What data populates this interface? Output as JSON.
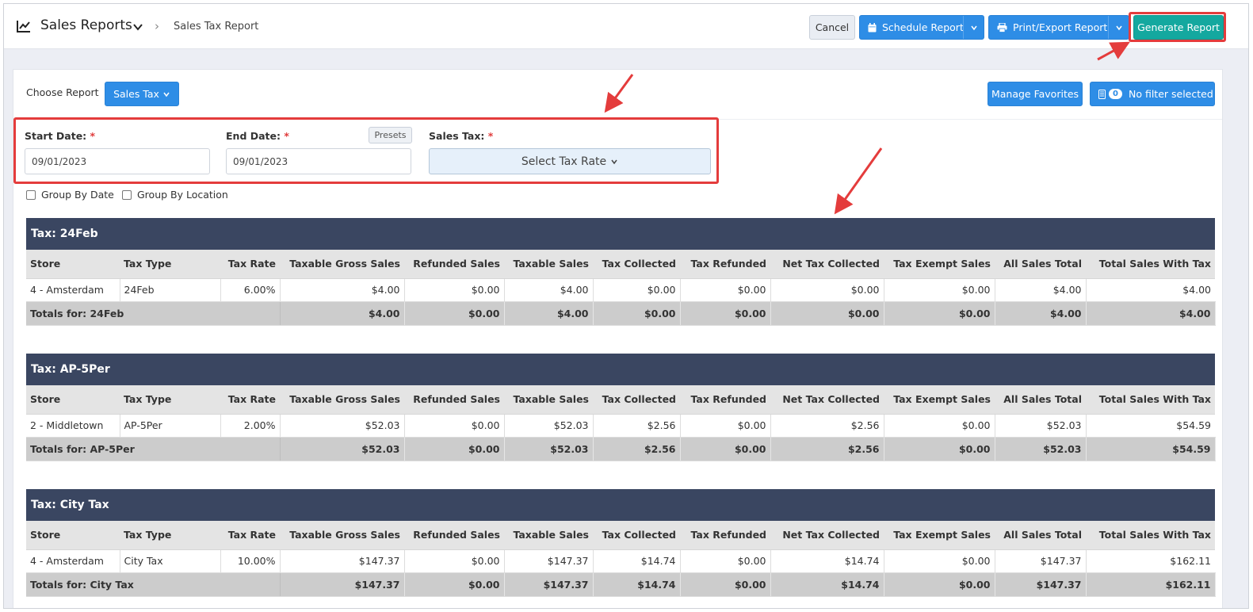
{
  "header": {
    "title": "Sales Reports",
    "breadcrumb_current": "Sales Tax Report",
    "cancel_label": "Cancel",
    "schedule_label": "Schedule Report",
    "print_label": "Print/Export Report",
    "generate_label": "Generate Report"
  },
  "controls": {
    "choose_report_label": "Choose Report",
    "report_select_value": "Sales Tax",
    "manage_favorites_label": "Manage Favorites",
    "filter_count": "0",
    "filter_label": "No filter selected"
  },
  "form": {
    "start_date_label": "Start Date:",
    "start_date_value": "09/01/2023",
    "end_date_label": "End Date:",
    "end_date_value": "09/01/2023",
    "presets_label": "Presets",
    "sales_tax_label": "Sales Tax:",
    "sales_tax_select": "Select Tax Rate",
    "required_mark": "*",
    "group_by_date_label": "Group By Date",
    "group_by_location_label": "Group By Location"
  },
  "columns": [
    "Store",
    "Tax Type",
    "Tax Rate",
    "Taxable Gross Sales",
    "Refunded Sales",
    "Taxable Sales",
    "Tax Collected",
    "Tax Refunded",
    "Net Tax Collected",
    "Tax Exempt Sales",
    "All Sales Total",
    "Total Sales With Tax"
  ],
  "sections": [
    {
      "title": "Tax: 24Feb",
      "row": [
        "4 - Amsterdam",
        "24Feb",
        "6.00%",
        "$4.00",
        "$0.00",
        "$4.00",
        "$0.00",
        "$0.00",
        "$0.00",
        "$0.00",
        "$4.00",
        "$4.00"
      ],
      "totals_label": "Totals for: 24Feb",
      "totals": [
        "$4.00",
        "$0.00",
        "$4.00",
        "$0.00",
        "$0.00",
        "$0.00",
        "$0.00",
        "$4.00",
        "$4.00"
      ]
    },
    {
      "title": "Tax: AP-5Per",
      "row": [
        "2 - Middletown",
        "AP-5Per",
        "2.00%",
        "$52.03",
        "$0.00",
        "$52.03",
        "$2.56",
        "$0.00",
        "$2.56",
        "$0.00",
        "$52.03",
        "$54.59"
      ],
      "totals_label": "Totals for: AP-5Per",
      "totals": [
        "$52.03",
        "$0.00",
        "$52.03",
        "$2.56",
        "$0.00",
        "$2.56",
        "$0.00",
        "$52.03",
        "$54.59"
      ]
    },
    {
      "title": "Tax: City Tax",
      "row": [
        "4 - Amsterdam",
        "City Tax",
        "10.00%",
        "$147.37",
        "$0.00",
        "$147.37",
        "$14.74",
        "$0.00",
        "$14.74",
        "$0.00",
        "$147.37",
        "$162.11"
      ],
      "totals_label": "Totals for: City Tax",
      "totals": [
        "$147.37",
        "$0.00",
        "$147.37",
        "$14.74",
        "$0.00",
        "$14.74",
        "$0.00",
        "$147.37",
        "$162.11"
      ]
    }
  ],
  "icons": {
    "report": "line-chart-icon",
    "calendar": "calendar-icon",
    "print": "printer-icon",
    "filter": "filter-list-icon"
  },
  "colors": {
    "primary": "#2e8de6",
    "generate": "#14a89f",
    "section_header": "#3a4661",
    "annotation": "#e43c3c"
  }
}
